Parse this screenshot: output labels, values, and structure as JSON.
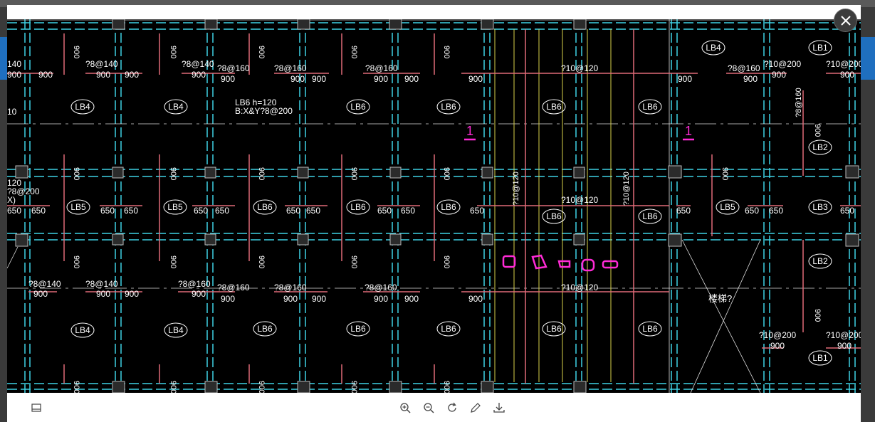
{
  "viewer": {
    "toolbar": {
      "panel_icon": "panel-icon",
      "zoom_in_icon": "zoom-in-icon",
      "zoom_out_icon": "zoom-out-icon",
      "rotate_icon": "rotate-icon",
      "edit_icon": "pencil-icon",
      "download_icon": "download-icon"
    },
    "close_icon": "close-icon"
  },
  "drawing": {
    "slab_tags": {
      "row1": [
        "LB4",
        "LB4",
        "LB6",
        "LB6",
        "LB6",
        "LB6",
        "LB4",
        "LB1"
      ],
      "row2": [
        "LB5",
        "LB5",
        "LB6",
        "LB6",
        "LB6",
        "LB6",
        "LB6",
        "LB5",
        "LB3",
        "LB2"
      ],
      "row3": [
        "LB4",
        "LB4",
        "LB6",
        "LB6",
        "LB6",
        "LB6",
        "LB6",
        "LB2",
        "LB1"
      ]
    },
    "note_lb6_line1": "LB6 h=120",
    "note_lb6_line2": "B:X&Y?8@200",
    "stair_label": "楼梯?",
    "rebar_labels": {
      "r8_140": "?8@140",
      "r8_160": "?8@160",
      "r10_120": "?10@120",
      "r10_200": "?10@200",
      "r8_160v": "?8@160",
      "left_top": "140",
      "left_mid1": "120",
      "left_mid2": "?8@200",
      "left_mid3": "X)",
      "left_10": "10",
      "r8_140b": "?8@140",
      "r8_140c": "?8@140",
      "r8_140d": "?8@140",
      "r8_160b": "?8@160",
      "r8_160c": "?8@160",
      "r8_160d": "?8@160",
      "r8_160e": "?8@160",
      "r8_160f": "?8@160",
      "r8_160g": "?8@160",
      "r10_120b": "?10@120",
      "r10_120c": "?10@120",
      "r10_120v1": "?10@120",
      "r10_120v2": "?10@120",
      "r10_200b": "?10@200",
      "r10_200c": "?10@200",
      "r10_200d": "?10@200",
      "r8_160v2": "?8@160"
    },
    "dims": {
      "d900": "900",
      "d650": "650",
      "d300": "900",
      "d900v": "900"
    },
    "markup_one": "1"
  }
}
